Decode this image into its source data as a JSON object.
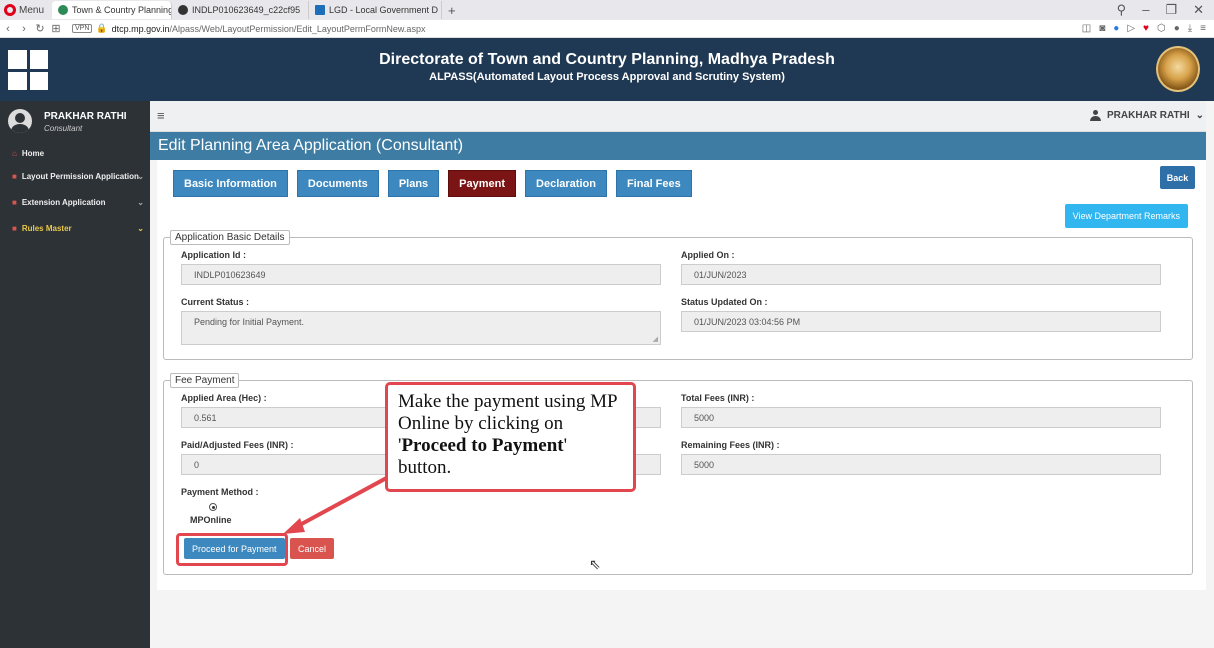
{
  "browser": {
    "menu_label": "Menu",
    "tabs": [
      {
        "label": "Town & Country Planning",
        "active": true
      },
      {
        "label": "INDLP010623649_c22cf95",
        "active": false
      },
      {
        "label": "LGD - Local Government D",
        "active": false
      }
    ],
    "new_tab": "+",
    "url_domain": "dtcp.mp.gov.in",
    "url_path": "/Alpass/Web/LayoutPermission/Edit_LayoutPermFormNew.aspx",
    "vpn_label": "VPN"
  },
  "header": {
    "title": "Directorate of Town and Country Planning, Madhya Pradesh",
    "subtitle": "ALPASS(Automated Layout Process Approval and Scrutiny System)"
  },
  "sidebar": {
    "user_name": "PRAKHAR RATHI",
    "user_role": "Consultant",
    "items": [
      {
        "label": "Home",
        "icon": "home-icon"
      },
      {
        "label": "Layout Permission Application",
        "icon": "folder-icon"
      },
      {
        "label": "Extension Application",
        "icon": "folder-icon"
      },
      {
        "label": "Rules Master",
        "icon": "folder-icon"
      }
    ]
  },
  "topbar": {
    "user_label": "PRAKHAR RATHI"
  },
  "page": {
    "title": "Edit Planning Area Application (Consultant)",
    "tabs": [
      "Basic Information",
      "Documents",
      "Plans",
      "Payment",
      "Declaration",
      "Final Fees"
    ],
    "active_tab": "Payment",
    "back_label": "Back",
    "remarks_label": "View Department Remarks"
  },
  "basic_details": {
    "legend": "Application Basic Details",
    "application_id_label": "Application Id :",
    "application_id": "INDLP010623649",
    "applied_on_label": "Applied On :",
    "applied_on": "01/JUN/2023",
    "current_status_label": "Current Status :",
    "current_status": "Pending for Initial Payment.",
    "status_updated_label": "Status Updated On :",
    "status_updated": "01/JUN/2023 03:04:56 PM"
  },
  "fee_payment": {
    "legend": "Fee Payment",
    "applied_area_label": "Applied Area (Hec) :",
    "applied_area": "0.561",
    "total_fees_label": "Total Fees (INR) :",
    "total_fees": "5000",
    "paid_label": "Paid/Adjusted Fees (INR) :",
    "paid": "0",
    "remaining_label": "Remaining Fees (INR) :",
    "remaining": "5000",
    "method_label": "Payment Method :",
    "method_option": "MPOnline",
    "proceed_label": "Proceed for Payment",
    "cancel_label": "Cancel"
  },
  "callout": {
    "line1": "Make the payment using MP Online by clicking on '",
    "bold": "Proceed to Payment",
    "line2": "' button."
  }
}
